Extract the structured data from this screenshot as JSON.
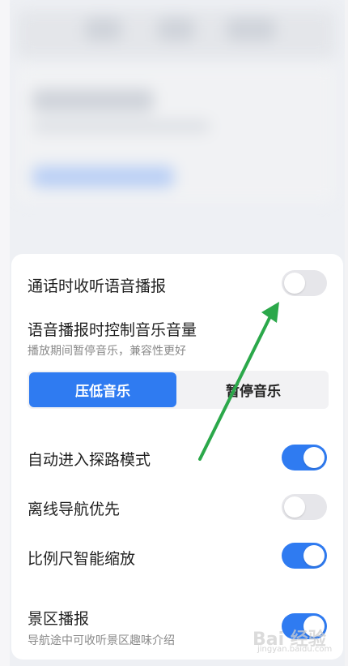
{
  "settings": [
    {
      "label": "通话时收听语音播报",
      "enabled": false
    },
    {
      "label": "语音播报时控制音乐音量",
      "description": "播放期间暂停音乐，兼容性更好"
    },
    {
      "label": "自动进入探路模式",
      "enabled": true
    },
    {
      "label": "离线导航优先",
      "enabled": false
    },
    {
      "label": "比例尺智能缩放",
      "enabled": true
    },
    {
      "label": "景区播报",
      "description": "导航途中可收听景区趣味介绍",
      "enabled": true
    }
  ],
  "music_mode": {
    "options": [
      "压低音乐",
      "暂停音乐"
    ],
    "selected": "压低音乐"
  },
  "annotation": {
    "color": "#2ba84a",
    "shape": "arrow"
  },
  "watermark": {
    "text": "Bai 经验",
    "subtext": "jingyan.baidu.com"
  },
  "colors": {
    "accent": "#2f7bf1",
    "toggle_off": "#e6e6ea"
  }
}
